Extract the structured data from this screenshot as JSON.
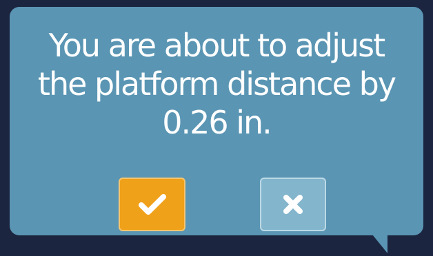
{
  "dialog": {
    "message_lines": [
      "You are about to adjust",
      "the platform distance by",
      "0.26 in."
    ],
    "confirm": {
      "icon": "checkmark-icon"
    },
    "cancel": {
      "icon": "close-icon"
    }
  },
  "colors": {
    "background": "#1b2540",
    "dialog": "#5a95b3",
    "confirm_button": "#f0a11a",
    "cancel_button": "#83b5cc",
    "text": "#ffffff"
  }
}
